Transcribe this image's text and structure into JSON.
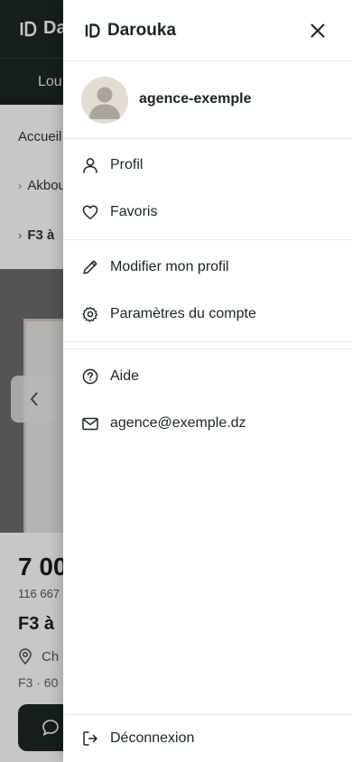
{
  "background": {
    "logo_text": "Da",
    "nav_tab": "Lou",
    "breadcrumbs": [
      "Accueil",
      "Akbou",
      "F3 à"
    ],
    "price": "7 00",
    "price_sub": "116 667",
    "listing_title": "F3 à",
    "location": "Ch",
    "meta": "F3 · 60"
  },
  "drawer": {
    "brand": "Darouka",
    "user": {
      "name": "agence-exemple"
    },
    "primary_items": [
      {
        "label": "Profil",
        "icon": "user-icon"
      },
      {
        "label": "Favoris",
        "icon": "heart-icon"
      }
    ],
    "account_items": [
      {
        "label": "Modifier mon profil",
        "icon": "pencil-icon"
      },
      {
        "label": "Paramètres du compte",
        "icon": "gear-icon"
      }
    ],
    "help_items": [
      {
        "label": "Aide",
        "icon": "help-circle-icon"
      },
      {
        "label": "agence@exemple.dz",
        "icon": "mail-icon"
      }
    ],
    "logout_label": "Déconnexion"
  }
}
